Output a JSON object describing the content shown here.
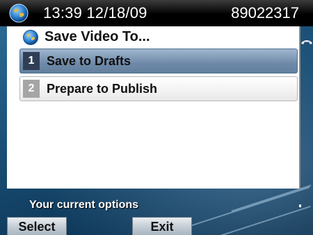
{
  "status_bar": {
    "time_date": "13:39 12/18/09",
    "extension": "89022317",
    "icon": "globe-icon"
  },
  "menu": {
    "title": "Save Video To...",
    "title_icon": "globe-icon",
    "items": [
      {
        "number": "1",
        "label": "Save to Drafts",
        "selected": true
      },
      {
        "number": "2",
        "label": "Prepare to Publish",
        "selected": false
      }
    ]
  },
  "footer": {
    "prompt": "Your current options",
    "softkeys": [
      {
        "label": "Select"
      },
      {
        "label": "Exit"
      }
    ]
  },
  "colors": {
    "selected_item": "#6f8aa8",
    "status_bar": "#000000",
    "panel": "#ffffff"
  }
}
